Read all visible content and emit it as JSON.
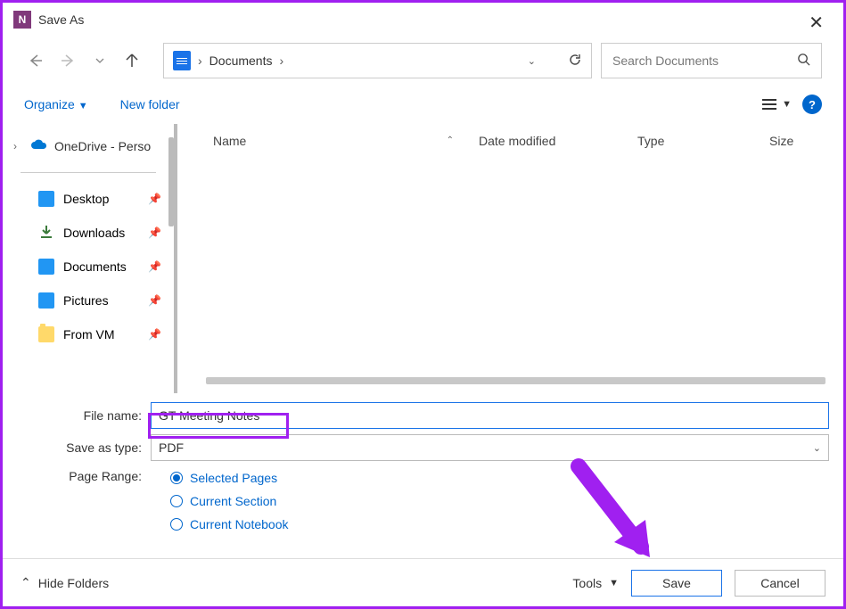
{
  "titlebar": {
    "title": "Save As"
  },
  "nav": {
    "breadcrumb": "Documents",
    "search_placeholder": "Search Documents"
  },
  "toolbar": {
    "organize": "Organize",
    "new_folder": "New folder"
  },
  "sidebar": {
    "top_item": "OneDrive - Perso",
    "quick": [
      {
        "icon": "desk",
        "label": "Desktop"
      },
      {
        "icon": "down",
        "label": "Downloads"
      },
      {
        "icon": "doc",
        "label": "Documents"
      },
      {
        "icon": "pic",
        "label": "Pictures"
      },
      {
        "icon": "folder",
        "label": "From VM"
      }
    ]
  },
  "columns": {
    "name": "Name",
    "date": "Date modified",
    "type": "Type",
    "size": "Size"
  },
  "form": {
    "filename_label": "File name:",
    "filename_value": "GT Meeting Notes",
    "savetype_label": "Save as type:",
    "savetype_value": "PDF",
    "pagerange_label": "Page Range:",
    "options": [
      {
        "label": "Selected Pages",
        "checked": true
      },
      {
        "label": "Current Section",
        "checked": false
      },
      {
        "label": "Current Notebook",
        "checked": false
      }
    ]
  },
  "footer": {
    "hide_folders": "Hide Folders",
    "tools": "Tools",
    "save": "Save",
    "cancel": "Cancel"
  }
}
